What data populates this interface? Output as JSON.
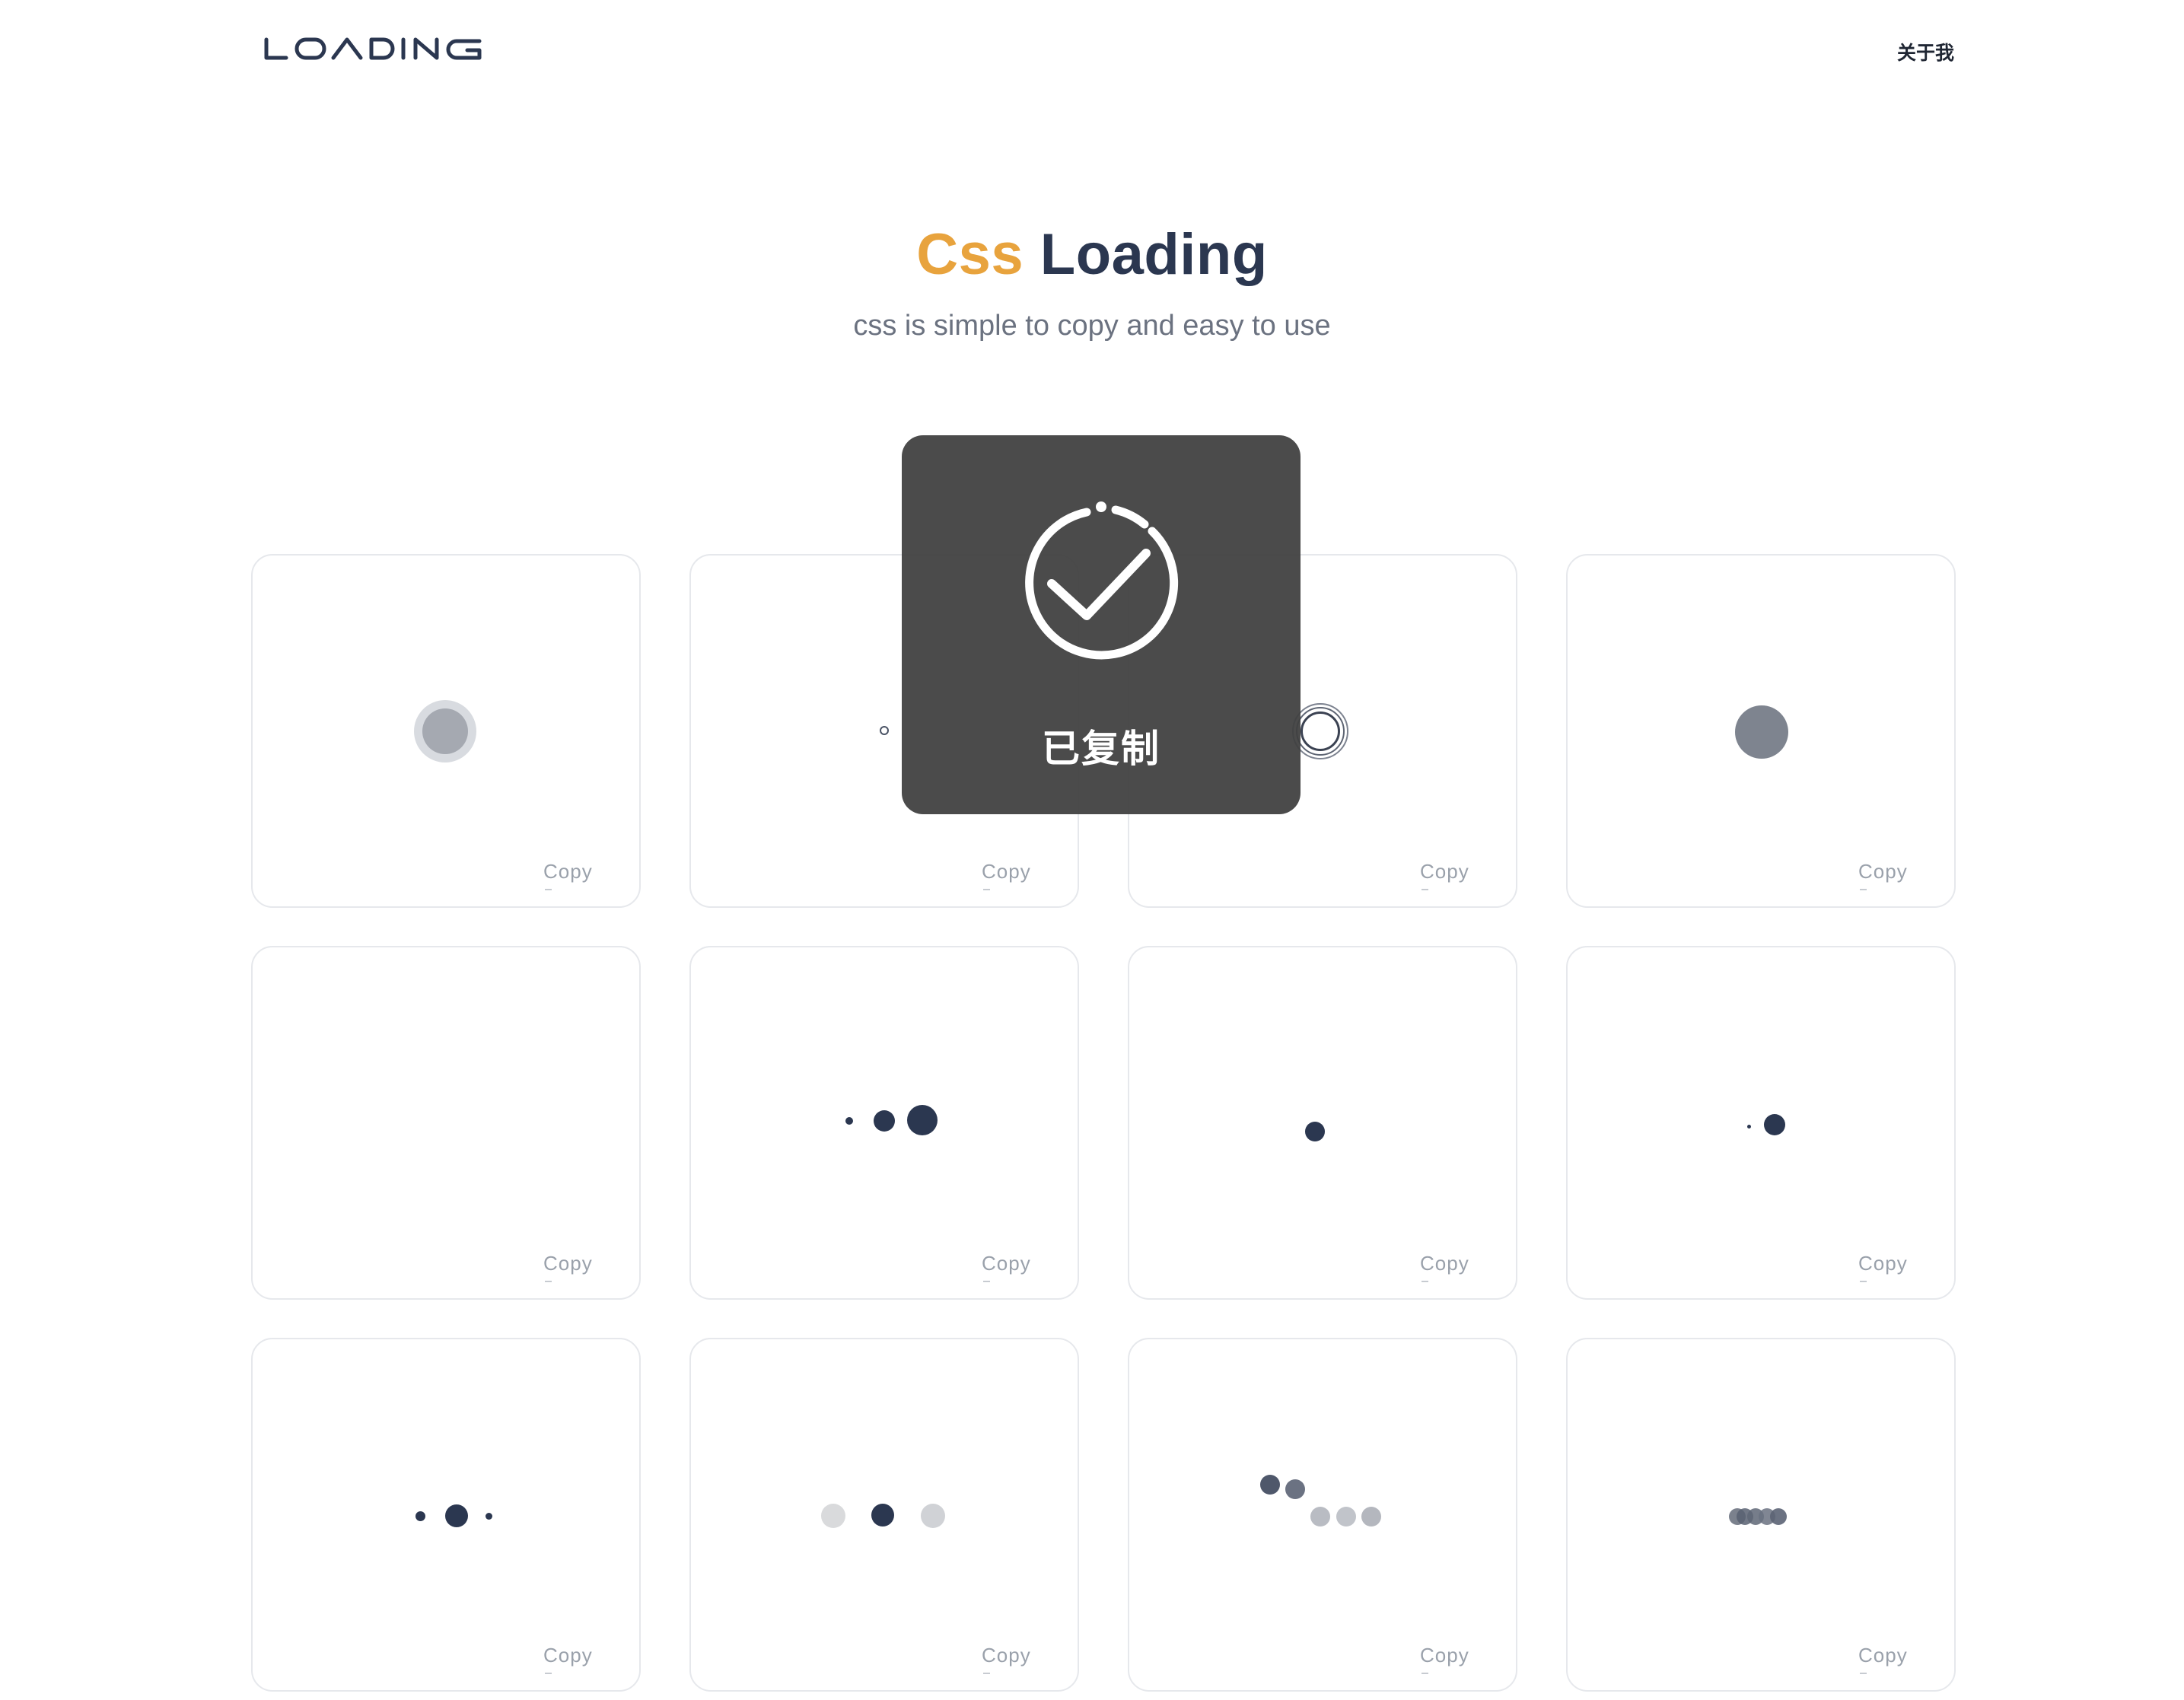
{
  "nav": {
    "logo_text": "LOADING",
    "about_label": "关于我"
  },
  "hero": {
    "title_accent": "Css",
    "title_main": "Loading",
    "subtitle": "css is simple to copy and easy to use"
  },
  "colors": {
    "accent": "#e8a33d",
    "title": "#2b3750",
    "dark_dot": "#2b3750",
    "toast_bg": "#404040"
  },
  "cards": [
    {
      "copy_label": "Copy",
      "loader": "pulse-ring"
    },
    {
      "copy_label": "Copy",
      "loader": "tiny-ring"
    },
    {
      "copy_label": "Copy",
      "loader": "ripple-rings"
    },
    {
      "copy_label": "Copy",
      "loader": "solid-dot"
    },
    {
      "copy_label": "Copy",
      "loader": "empty"
    },
    {
      "copy_label": "Copy",
      "loader": "growing-dots"
    },
    {
      "copy_label": "Copy",
      "loader": "single-dot"
    },
    {
      "copy_label": "Copy",
      "loader": "orbit-dots"
    },
    {
      "copy_label": "Copy",
      "loader": "three-dots-scale"
    },
    {
      "copy_label": "Copy",
      "loader": "three-dots-fade"
    },
    {
      "copy_label": "Copy",
      "loader": "wave-dots"
    },
    {
      "copy_label": "Copy",
      "loader": "stacked-dots"
    }
  ],
  "toast": {
    "icon": "check-circle-icon",
    "message": "已复制"
  }
}
